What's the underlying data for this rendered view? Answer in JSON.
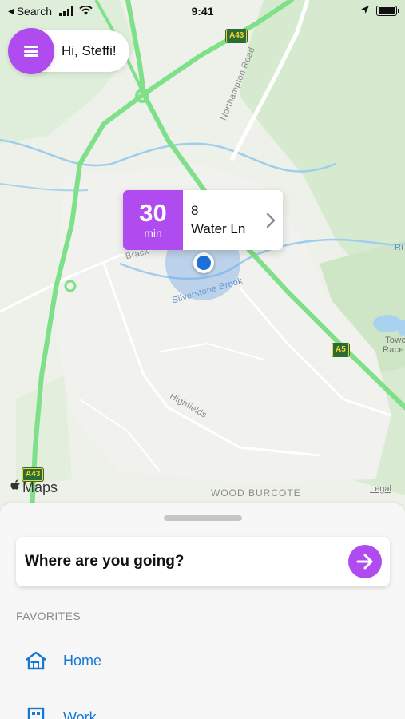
{
  "status_bar": {
    "back_label": "Search",
    "time": "9:41"
  },
  "greeting": {
    "menu_icon": "hamburger-menu-icon",
    "text": "Hi, Steffi!"
  },
  "map": {
    "labels": {
      "northampton_road": "Northampton Road",
      "silverstone_brook": "Silverstone Brook",
      "highfields": "Highfields",
      "wood_burcote": "WOOD BURCOTE",
      "brack": "Brack",
      "ri": "Ri",
      "towc": "Towc",
      "race": "Race"
    },
    "shields": {
      "a43_top": "A43",
      "a43_bottom": "A43",
      "a5": "A5"
    },
    "attribution": "Maps",
    "legal": "Legal",
    "colors": {
      "land": "#eef0ea",
      "park": "#cfe6c6",
      "water": "#a8d2ef",
      "highway": "#7fe08a"
    }
  },
  "callout": {
    "eta_value": "30",
    "eta_unit": "min",
    "address_line1": "8",
    "address_line2": "Water Ln",
    "chevron_icon": "chevron-right-icon"
  },
  "sheet": {
    "search_placeholder": "Where are you going?",
    "go_icon": "arrow-right-icon",
    "favorites_title": "FAVORITES",
    "favorites": [
      {
        "label": "Home",
        "icon": "house-icon"
      },
      {
        "label": "Work",
        "icon": "building-icon"
      }
    ]
  },
  "accent_color": "#b04bef",
  "link_color": "#1578d3"
}
